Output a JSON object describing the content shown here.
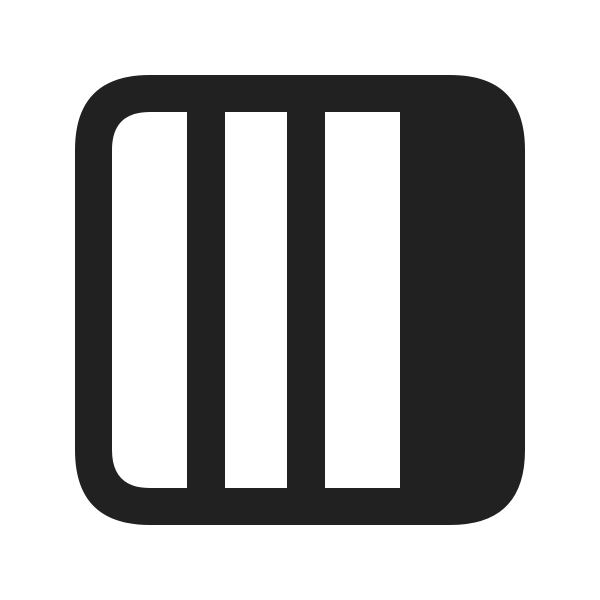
{
  "icon": {
    "name": "column-layout-icon",
    "fill_color": "#212121",
    "background_color": "#ffffff",
    "column_count": 3,
    "trailing_panel_filled": true
  }
}
